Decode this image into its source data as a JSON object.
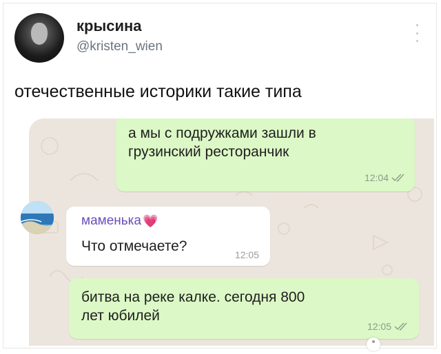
{
  "tweet": {
    "display_name": "крысина",
    "username": "@kristen_wien",
    "text": "отечественные историки такие типа"
  },
  "chat": {
    "background_color": "#ece5dd",
    "messages": [
      {
        "direction": "outgoing",
        "text": "а мы с подружками зашли в\nгрузинский ресторанчик",
        "time": "12:04",
        "status_icon": "double-check-icon"
      },
      {
        "direction": "incoming",
        "sender": "маменька",
        "sender_emoji": "💗",
        "text": "Что отмечаете?",
        "time": "12:05"
      },
      {
        "direction": "outgoing",
        "text": "битва на реке калке. сегодня 800\nлет юбилей",
        "time": "12:05",
        "status_icon": "double-check-icon"
      }
    ]
  },
  "colors": {
    "outgoing_bubble": "#dcf8c6",
    "incoming_bubble": "#ffffff",
    "sender_name": "#6b4fb8"
  }
}
